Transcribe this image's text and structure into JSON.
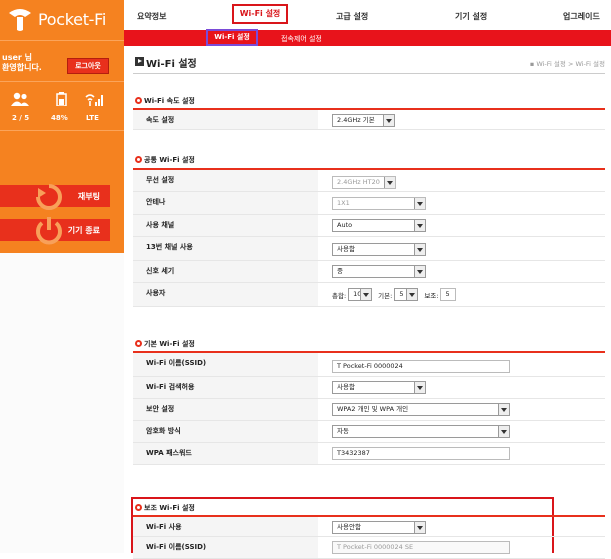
{
  "sidebar": {
    "logo": "Pocket-Fi",
    "user_line1": "user 님",
    "user_line2": "환영합니다.",
    "logout": "로그아웃",
    "status": {
      "users": "2 / 5",
      "battery": "48%",
      "network": "LTE"
    },
    "reboot": "재부팅",
    "shutdown": "기기 종료"
  },
  "nav": {
    "items": [
      "요약정보",
      "Wi-Fi 설정",
      "고급 설정",
      "기기 설정",
      "업그레이드"
    ],
    "active": "Wi-Fi 설정",
    "sub_items": [
      "Wi-Fi 설정",
      "접속제어 설정"
    ]
  },
  "page": {
    "title": "Wi-Fi 설정",
    "breadcrumb": "▪ Wi-Fi 설정 > Wi-Fi 설정"
  },
  "speed": {
    "title": "Wi-Fi 속도 설정",
    "label": "속도 설정",
    "value": "2.4GHz 기본"
  },
  "common": {
    "title": "공통 Wi-Fi 설정",
    "wireless_label": "무선 설정",
    "wireless_value": "2.4GHz HT20",
    "antenna_label": "안테나",
    "antenna_value": "1X1",
    "channel_label": "사용 채널",
    "channel_value": "Auto",
    "ch13_label": "13번 채널 사용",
    "ch13_value": "사용함",
    "signal_label": "신호 세기",
    "signal_value": "중",
    "users_label": "사용자",
    "total_label": "총합:",
    "total_value": "10",
    "basic_label": "기본:",
    "basic_value": "5",
    "aux_label": "보조:",
    "aux_value": "5"
  },
  "basic": {
    "title": "기본 Wi-Fi 설정",
    "ssid_label": "Wi-Fi 이름(SSID)",
    "ssid_value": "T Pocket-Fi 0000024",
    "search_label": "Wi-Fi 검색허용",
    "search_value": "사용함",
    "security_label": "보안 설정",
    "security_value": "WPA2 개인 및 WPA 개인",
    "encrypt_label": "암호화 방식",
    "encrypt_value": "자동",
    "password_label": "WPA 패스워드",
    "password_value": "T3432387"
  },
  "aux": {
    "title": "보조 Wi-Fi 설정",
    "use_label": "Wi-Fi 사용",
    "use_value": "사용안함",
    "ssid_label": "Wi-Fi 이름(SSID)",
    "ssid_value": "T Pocket-Fi 0000024 SE"
  },
  "colors": {
    "orange": "#f58220",
    "red": "#e8131b",
    "highlight": "#d9151a",
    "sub_highlight": "#7a4bd8"
  }
}
